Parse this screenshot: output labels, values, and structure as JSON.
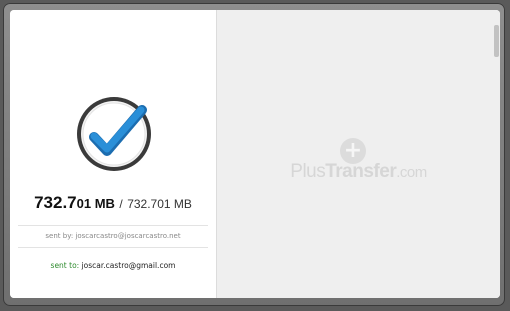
{
  "transfer": {
    "size_done_main": "732.7",
    "size_done_small": "01 MB",
    "size_separator": "/",
    "size_total": "732.701 MB",
    "sent_by_label": "sent by:",
    "sent_by_value": "joscarcastro@joscarcastro.net",
    "sent_to_label": "sent to:",
    "sent_to_value": "joscar.castro@gmail.com",
    "status_icon": "checkmark-icon"
  },
  "brand": {
    "plus_glyph": "+",
    "name_part1": "Plus",
    "name_part2": "Transfer",
    "name_part3": ".com"
  },
  "colors": {
    "check_blue": "#2a8fd8",
    "sent_to_label": "#2e8b2e"
  }
}
